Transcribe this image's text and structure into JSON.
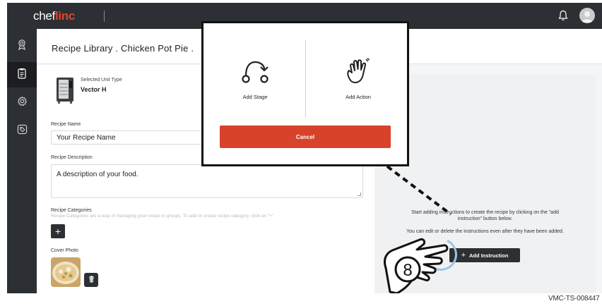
{
  "app": {
    "brand_prefix": "chef",
    "brand_suffix": "linc"
  },
  "header": {
    "breadcrumb": "Recipe Library . Chicken Pot Pie ."
  },
  "sidebar": {
    "items": [
      {
        "icon": "ribbon-icon",
        "active": false
      },
      {
        "icon": "clipboard-icon",
        "active": true
      },
      {
        "icon": "gear-icon",
        "active": false
      },
      {
        "icon": "tag-icon",
        "active": false
      }
    ]
  },
  "unit": {
    "label": "Selected Unit Type",
    "value": "Vector H"
  },
  "form": {
    "recipe_name_label": "Recipe Name",
    "recipe_name_value": "Your Recipe Name",
    "recipe_description_label": "Recipe Description",
    "recipe_description_value": "A description of your food.",
    "categories_label": "Recipe Categories",
    "categories_hint": "Recipe Categories are a way of managing your recipe in groups. To add or create recipe category, click on \"+\".",
    "add_category_label": "+",
    "cover_photo_label": "Cover Photo"
  },
  "instructions": {
    "help_line1": "Start adding instructions to create the recipe by clicking on the \"add instruction\" button below.",
    "help_line2": "You can edit or delete the instructions even after they have been added.",
    "add_instruction_label": "Add Instruction",
    "add_instruction_icon": "+"
  },
  "modal": {
    "option_stage_label": "Add Stage",
    "option_action_label": "Add Action",
    "cancel_label": "Cancel"
  },
  "callout": {
    "step_number": "8"
  },
  "footer": {
    "reference_code": "VMC-TS-008447"
  },
  "colors": {
    "accent": "#d9422a",
    "dark": "#2c2f33"
  }
}
